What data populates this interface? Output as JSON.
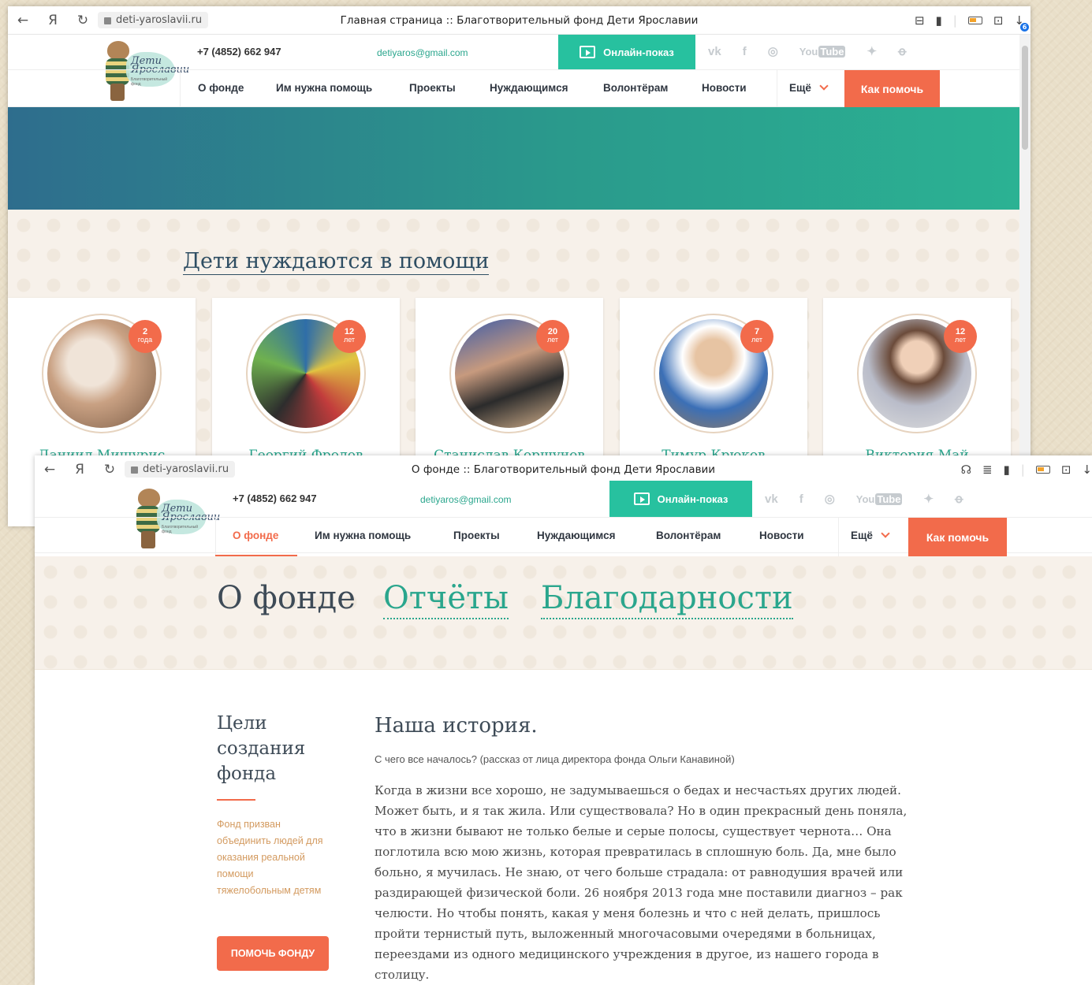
{
  "colors": {
    "accent": "#f26b4b",
    "teal": "#27c19f",
    "link": "#2aa68d"
  },
  "window1": {
    "browser": {
      "back": "←",
      "yandex": "Я",
      "reload": "↻",
      "url": "deti-yaroslavii.ru",
      "tab_title": "Главная страница :: Благотворительный фонд Дети Ярославии",
      "download_count": "6"
    },
    "header": {
      "logo_text": "Дети Ярославии",
      "logo_sub": "Благотворительный фонд",
      "phone": "+7 (4852) 662 947",
      "email": "detiyaros@gmail.com",
      "online_label": "Онлайн-показ",
      "social": [
        "vk",
        "f",
        "◎",
        "You",
        "Tube",
        "✦",
        "ꝋ"
      ]
    },
    "nav": {
      "items": [
        "О фонде",
        "Им нужна помощь",
        "Проекты",
        "Нуждающимся",
        "Волонтёрам",
        "Новости"
      ],
      "more": "Ещё",
      "help": "Как помочь"
    },
    "section_title": "Дети нуждаются в помощи",
    "children": [
      {
        "name": "Даниил Мишурис",
        "age_num": "2",
        "age_unit": "года"
      },
      {
        "name": "Георгий Фролов",
        "age_num": "12",
        "age_unit": "лет"
      },
      {
        "name": "Станислав Коршунов",
        "age_num": "20",
        "age_unit": "лет"
      },
      {
        "name": "Тимур Крюков",
        "age_num": "7",
        "age_unit": "лет"
      },
      {
        "name": "Виктория Май",
        "age_num": "12",
        "age_unit": "лет"
      }
    ]
  },
  "window2": {
    "browser": {
      "back": "←",
      "yandex": "Я",
      "reload": "↻",
      "url": "deti-yaroslavii.ru",
      "tab_title": "О фонде :: Благотворительный фонд Дети Ярославии"
    },
    "header": {
      "logo_text": "Дети Ярославии",
      "logo_sub": "Благотворительный фонд",
      "phone": "+7 (4852) 662 947",
      "email": "detiyaros@gmail.com",
      "online_label": "Онлайн-показ",
      "social": [
        "vk",
        "f",
        "◎",
        "You",
        "Tube",
        "✦",
        "ꝋ"
      ]
    },
    "nav": {
      "items": [
        "О фонде",
        "Им нужна помощь",
        "Проекты",
        "Нуждающимся",
        "Волонтёрам",
        "Новости"
      ],
      "more": "Ещё",
      "help": "Как помочь"
    },
    "page_tabs": {
      "current": "О фонде",
      "reports": "Отчёты",
      "thanks": "Благодарности"
    },
    "aside": {
      "title": "Цели создания фонда",
      "text": "Фонд призван объединить людей для оказания реальной помощи тяжелобольным детям",
      "button": "ПОМОЧЬ ФОНДУ"
    },
    "article": {
      "title": "Наша история.",
      "lead": "С чего все началось? (рассказ от лица директора фонда Ольги Канавиной)",
      "body": "Когда в жизни все хорошо, не задумываешься о бедах и несчастьях других людей. Может быть, и я так жила. Или существовала? Но в один прекрасный день поняла, что в жизни бывают не только белые и серые полосы, существует чернота… Она поглотила всю мою жизнь, которая превратилась в сплошную боль. Да, мне было больно, я мучилась. Не знаю, от чего больше страдала: от равнодушия врачей или раздирающей физической боли. 26 ноября 2013 года мне поставили диагноз – рак челюсти. Но чтобы понять, какая у меня болезнь и что с ней делать, пришлось пройти тернистый путь, выложенный многочасовыми очередями в больницах, переездами из одного медицинского учреждения в другое, из нашего города в столицу."
    }
  }
}
